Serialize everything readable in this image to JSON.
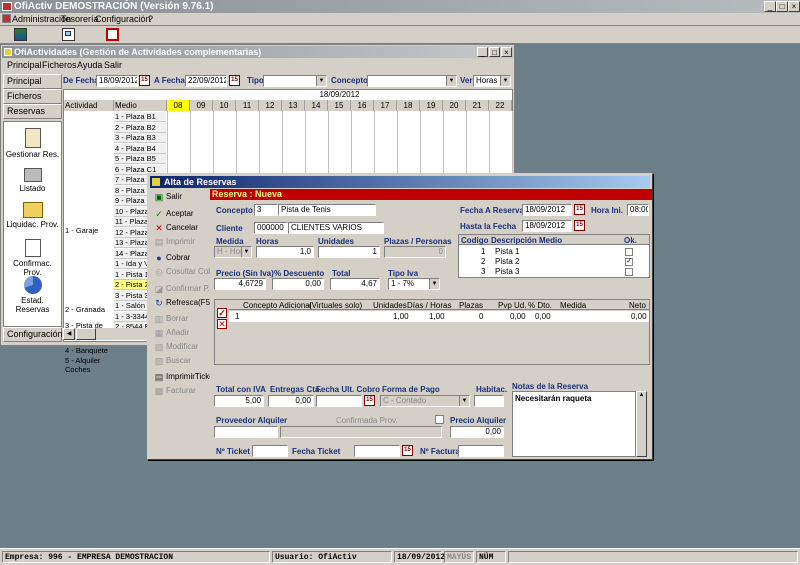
{
  "app": {
    "title": "OfiActiv DEMOSTRACIÓN (Versión 9.76.1)"
  },
  "menu": [
    "Administración",
    "Tesorería",
    "Configuración",
    "?"
  ],
  "child": {
    "title": "OfiActividades (Gestión de Actividades complementarias)",
    "menu": [
      "Principal",
      "Ficheros",
      "Ayuda",
      "Salir"
    ],
    "nav_tabs": [
      "Principal",
      "Ficheros",
      "Reservas",
      "Configuración"
    ],
    "nav_items": [
      "Gestionar Res.",
      "Listado",
      "Liquidac. Prov.",
      "Confirmac. Prov.",
      "Estad. Reservas"
    ],
    "filters": {
      "de_fecha_label": "De Fecha",
      "de_fecha": "18/09/2012",
      "a_fecha_label": "A Fecha",
      "a_fecha": "22/09/2012",
      "tipo_label": "Tipo",
      "tipo": "",
      "concepto_label": "Concepto",
      "concepto": "",
      "ver_label": "Ver",
      "ver": "Horas"
    },
    "grid": {
      "date": "18/09/2012",
      "col_actividad": "Actividad",
      "col_medio": "Medio",
      "hours": [
        "08",
        "09",
        "10",
        "11",
        "12",
        "13",
        "14",
        "15",
        "16",
        "17",
        "18",
        "19",
        "20",
        "21",
        "22"
      ],
      "groups": [
        {
          "name": "1 - Garaje"
        },
        {
          "name": "2 - Granada"
        },
        {
          "name": "3 - Pista de Tenis"
        },
        {
          "name": "4 - Banquete"
        },
        {
          "name": "5 - Alquiler Coches"
        }
      ],
      "medios": [
        "1 - Plaza B1",
        "2 - Plaza B2",
        "3 - Plaza B3",
        "4 - Plaza B4",
        "5 - Plaza B5",
        "6 - Plaza C1",
        "7 - Plaza C2",
        "8 - Plaza C3",
        "9 - Plaza C4",
        "10 - Plaza D1",
        "11 - Plaza D2",
        "12 - Plaza D3",
        "13 - Plaza D4",
        "14 - Plaza D5",
        "1 - Ida y V",
        "1 - Pista 1",
        "2 - Pista 2",
        "3 - Pista 3",
        "1 - Salón",
        "1 - 3-3344",
        "2 - 8544 B"
      ]
    }
  },
  "dialog": {
    "title": "Alta de Reservas",
    "header": "Reserva : Nueva",
    "side_buttons": [
      {
        "label": "Salir",
        "icon": "exit-icon",
        "enabled": true
      },
      {
        "label": "Aceptar",
        "icon": "check-icon",
        "enabled": true
      },
      {
        "label": "Cancelar",
        "icon": "x-icon",
        "enabled": true
      },
      {
        "label": "Imprimir",
        "icon": "print-icon",
        "enabled": false
      },
      {
        "label": "Cobrar",
        "icon": "coins-icon",
        "enabled": true
      },
      {
        "label": "Cosultar Cobr",
        "icon": "search-icon",
        "enabled": false
      },
      {
        "label": "Confirmar P.",
        "icon": "confirm-icon",
        "enabled": false
      },
      {
        "label": "Refresca(F5",
        "icon": "refresh-icon",
        "enabled": true
      },
      {
        "label": "Borrar",
        "icon": "delete-icon",
        "enabled": false
      },
      {
        "label": "Añadir",
        "icon": "add-icon",
        "enabled": false
      },
      {
        "label": "Modificar",
        "icon": "edit-icon",
        "enabled": false
      },
      {
        "label": "Buscar",
        "icon": "find-icon",
        "enabled": false
      },
      {
        "label": "ImprimirTicket",
        "icon": "ticket-icon",
        "enabled": true
      },
      {
        "label": "Facturar",
        "icon": "invoice-icon",
        "enabled": false
      }
    ],
    "concepto_label": "Concepto",
    "concepto_code": "3",
    "concepto_name": "Pista de Tenis",
    "cliente_label": "Cliente",
    "cliente_code": "000000",
    "cliente_name": "CLIENTES VARIOS",
    "medida_label": "Medida",
    "medida": "H - Hora",
    "horas_label": "Horas",
    "horas": "1,0",
    "unidades_label": "Unidades",
    "unidades": "1",
    "plazas_label": "Plazas / Personas",
    "plazas": "0",
    "precio_label": "Precio (Sin Iva)",
    "precio": "4,6729",
    "descuento_label": "% Descuento",
    "descuento": "0,00",
    "total_label": "Total",
    "total": "4,67",
    "tipo_iva_label": "Tipo Iva",
    "tipo_iva": "1 - 7%",
    "fecha_reservar_label": "Fecha A Reservar",
    "fecha_reservar": "18/09/2012",
    "hora_ini_label": "Hora Ini.",
    "hora_ini": "08:00",
    "hasta_fecha_label": "Hasta la Fecha",
    "hasta_fecha": "18/09/2012",
    "medios_table": {
      "headers": [
        "Codigo",
        "Descripción Medio",
        "Ok."
      ],
      "rows": [
        {
          "code": "1",
          "desc": "Pista 1",
          "ok": false
        },
        {
          "code": "2",
          "desc": "Pista 2",
          "ok": true
        },
        {
          "code": "3",
          "desc": "Pista 3",
          "ok": false
        }
      ]
    },
    "conceptos_table": {
      "headers": [
        "Concepto Adicional",
        "(Virtuales solo)",
        "Unidades",
        "Días / Horas",
        "Plazas",
        "Pvp Ud.",
        "% Dto.",
        "Medida",
        "Neto"
      ],
      "row": [
        "1",
        "",
        "1,00",
        "1,00",
        "0",
        "0,00",
        "0,00",
        "",
        "0,00"
      ]
    },
    "total_iva_label": "Total con IVA",
    "total_iva": "5,00",
    "entregas_label": "Entregas Cta.",
    "entregas": "0,00",
    "fecha_cobro_label": "Fecha Ult. Cobro",
    "fecha_cobro": "",
    "forma_pago_label": "Forma de Pago",
    "forma_pago": "C - Contado",
    "habitac_label": "Habitac.",
    "habitac": "",
    "notas_label": "Notas de la Reserva",
    "notas": "Necesitarán raqueta",
    "proveedor_label": "Proveedor Alquiler",
    "proveedor": "",
    "confirmada_label": "Confirmada Prov.",
    "precio_alquiler_label": "Precio Alquiler",
    "precio_alquiler": "0,00",
    "ticket_label": "Nº Ticket",
    "ticket": "",
    "fecha_ticket_label": "Fecha Ticket",
    "fecha_ticket": "",
    "factura_label": "Nº Factura",
    "factura": ""
  },
  "status": {
    "empresa": "Empresa: 996 - EMPRESA DEMOSTRACION",
    "usuario": "Usuario: OfiActiv",
    "fecha": "18/09/2012",
    "mayus": "MAYÚS",
    "num": "NÚM"
  }
}
